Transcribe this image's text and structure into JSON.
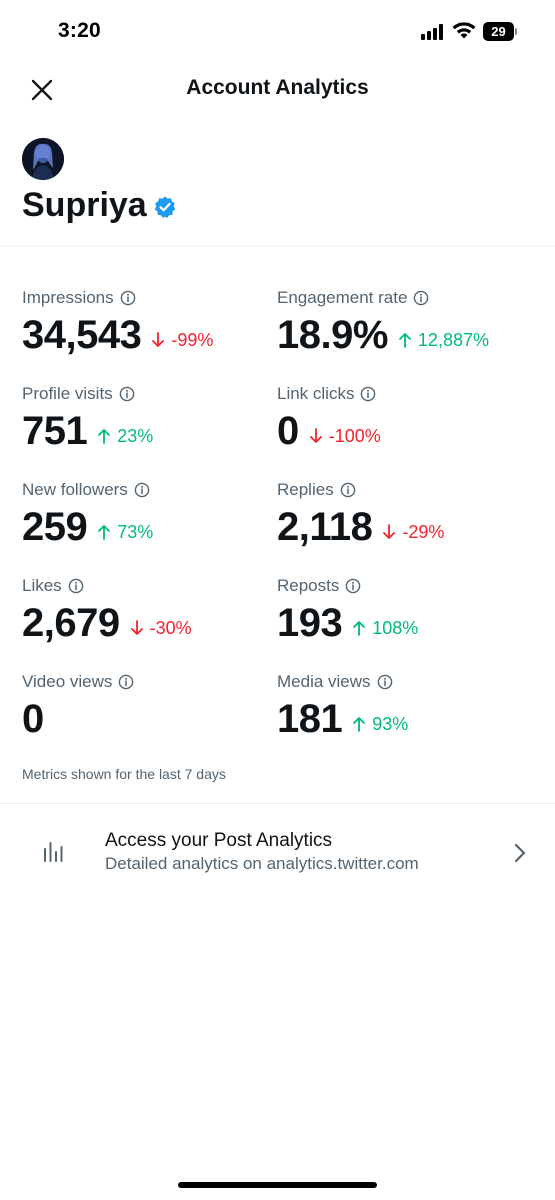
{
  "status_bar": {
    "time": "3:20",
    "battery": "29",
    "icons": [
      "signal-icon",
      "wifi-icon",
      "battery-icon"
    ]
  },
  "header": {
    "title": "Account Analytics",
    "close_icon": "close-icon"
  },
  "profile": {
    "name": "Supriya",
    "verified_icon": "verified-badge-icon",
    "badge_color": "#1d9bf0"
  },
  "metrics": [
    {
      "label": "Impressions",
      "value": "34,543",
      "change": "-99%",
      "direction": "down"
    },
    {
      "label": "Engagement rate",
      "value": "18.9%",
      "change": "12,887%",
      "direction": "up"
    },
    {
      "label": "Profile visits",
      "value": "751",
      "change": "23%",
      "direction": "up"
    },
    {
      "label": "Link clicks",
      "value": "0",
      "change": "-100%",
      "direction": "down"
    },
    {
      "label": "New followers",
      "value": "259",
      "change": "73%",
      "direction": "up"
    },
    {
      "label": "Replies",
      "value": "2,118",
      "change": "-29%",
      "direction": "down"
    },
    {
      "label": "Likes",
      "value": "2,679",
      "change": "-30%",
      "direction": "down"
    },
    {
      "label": "Reposts",
      "value": "193",
      "change": "108%",
      "direction": "up"
    },
    {
      "label": "Video views",
      "value": "0",
      "change": "",
      "direction": ""
    },
    {
      "label": "Media views",
      "value": "181",
      "change": "93%",
      "direction": "up"
    }
  ],
  "footnote": "Metrics shown for the last 7 days",
  "post_analytics": {
    "title": "Access your Post Analytics",
    "subtitle": "Detailed analytics on analytics.twitter.com",
    "icon": "bar-chart-icon",
    "chevron": "chevron-right-icon"
  },
  "colors": {
    "up": "#00ba7c",
    "down": "#f4212e",
    "text_primary": "#0f1419",
    "text_secondary": "#536471"
  }
}
